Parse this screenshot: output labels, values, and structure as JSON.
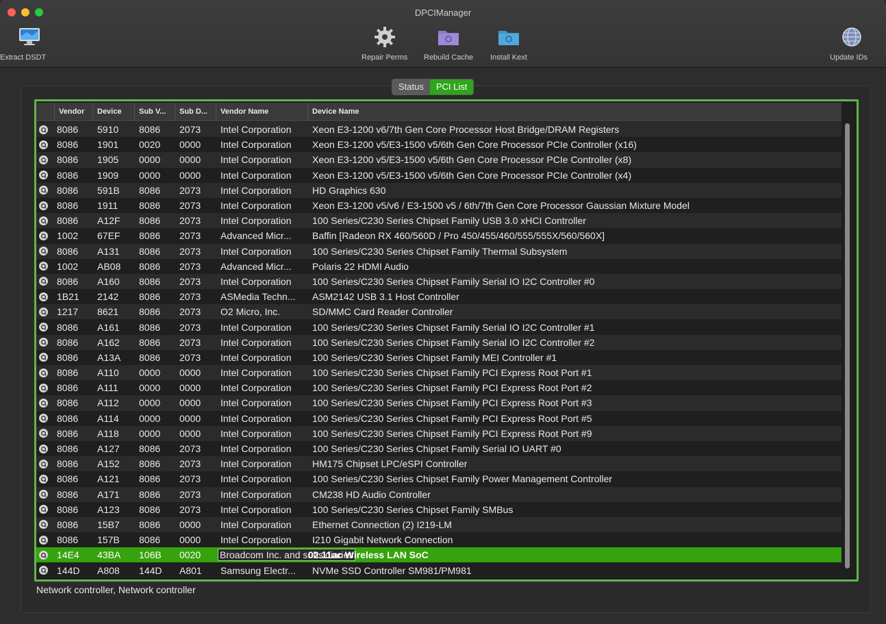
{
  "window": {
    "title": "DPCIManager"
  },
  "toolbar": {
    "extract_dsdt": "Extract DSDT",
    "repair_perms": "Repair Perms",
    "rebuild_cache": "Rebuild Cache",
    "install_kext": "Install Kext",
    "update_ids": "Update IDs"
  },
  "tabs": {
    "status": "Status",
    "pci_list": "PCI List",
    "active": "PCI List"
  },
  "table": {
    "columns": [
      "Vendor",
      "Device",
      "Sub V...",
      "Sub D...",
      "Vendor Name",
      "Device Name"
    ],
    "rows": [
      [
        "8086",
        "5910",
        "8086",
        "2073",
        "Intel Corporation",
        "Xeon E3-1200 v6/7th Gen Core Processor Host Bridge/DRAM Registers"
      ],
      [
        "8086",
        "1901",
        "0020",
        "0000",
        "Intel Corporation",
        "Xeon E3-1200 v5/E3-1500 v5/6th Gen Core Processor PCIe Controller (x16)"
      ],
      [
        "8086",
        "1905",
        "0000",
        "0000",
        "Intel Corporation",
        "Xeon E3-1200 v5/E3-1500 v5/6th Gen Core Processor PCIe Controller (x8)"
      ],
      [
        "8086",
        "1909",
        "0000",
        "0000",
        "Intel Corporation",
        "Xeon E3-1200 v5/E3-1500 v5/6th Gen Core Processor PCIe Controller (x4)"
      ],
      [
        "8086",
        "591B",
        "8086",
        "2073",
        "Intel Corporation",
        "HD Graphics 630"
      ],
      [
        "8086",
        "1911",
        "8086",
        "2073",
        "Intel Corporation",
        "Xeon E3-1200 v5/v6 / E3-1500 v5 / 6th/7th Gen Core Processor Gaussian Mixture Model"
      ],
      [
        "8086",
        "A12F",
        "8086",
        "2073",
        "Intel Corporation",
        "100 Series/C230 Series Chipset Family USB 3.0 xHCI Controller"
      ],
      [
        "1002",
        "67EF",
        "8086",
        "2073",
        "Advanced Micr...",
        "Baffin [Radeon RX 460/560D / Pro 450/455/460/555/555X/560/560X]"
      ],
      [
        "8086",
        "A131",
        "8086",
        "2073",
        "Intel Corporation",
        "100 Series/C230 Series Chipset Family Thermal Subsystem"
      ],
      [
        "1002",
        "AB08",
        "8086",
        "2073",
        "Advanced Micr...",
        "Polaris 22 HDMI Audio"
      ],
      [
        "8086",
        "A160",
        "8086",
        "2073",
        "Intel Corporation",
        "100 Series/C230 Series Chipset Family Serial IO I2C Controller #0"
      ],
      [
        "1B21",
        "2142",
        "8086",
        "2073",
        "ASMedia Techn...",
        "ASM2142 USB 3.1 Host Controller"
      ],
      [
        "1217",
        "8621",
        "8086",
        "2073",
        "O2 Micro, Inc.",
        "SD/MMC Card Reader Controller"
      ],
      [
        "8086",
        "A161",
        "8086",
        "2073",
        "Intel Corporation",
        "100 Series/C230 Series Chipset Family Serial IO I2C Controller #1"
      ],
      [
        "8086",
        "A162",
        "8086",
        "2073",
        "Intel Corporation",
        "100 Series/C230 Series Chipset Family Serial IO I2C Controller #2"
      ],
      [
        "8086",
        "A13A",
        "8086",
        "2073",
        "Intel Corporation",
        "100 Series/C230 Series Chipset Family MEI Controller #1"
      ],
      [
        "8086",
        "A110",
        "0000",
        "0000",
        "Intel Corporation",
        "100 Series/C230 Series Chipset Family PCI Express Root Port #1"
      ],
      [
        "8086",
        "A111",
        "0000",
        "0000",
        "Intel Corporation",
        "100 Series/C230 Series Chipset Family PCI Express Root Port #2"
      ],
      [
        "8086",
        "A112",
        "0000",
        "0000",
        "Intel Corporation",
        "100 Series/C230 Series Chipset Family PCI Express Root Port #3"
      ],
      [
        "8086",
        "A114",
        "0000",
        "0000",
        "Intel Corporation",
        "100 Series/C230 Series Chipset Family PCI Express Root Port #5"
      ],
      [
        "8086",
        "A118",
        "0000",
        "0000",
        "Intel Corporation",
        "100 Series/C230 Series Chipset Family PCI Express Root Port #9"
      ],
      [
        "8086",
        "A127",
        "8086",
        "2073",
        "Intel Corporation",
        "100 Series/C230 Series Chipset Family Serial IO UART #0"
      ],
      [
        "8086",
        "A152",
        "8086",
        "2073",
        "Intel Corporation",
        "HM175 Chipset LPC/eSPI Controller"
      ],
      [
        "8086",
        "A121",
        "8086",
        "2073",
        "Intel Corporation",
        "100 Series/C230 Series Chipset Family Power Management Controller"
      ],
      [
        "8086",
        "A171",
        "8086",
        "2073",
        "Intel Corporation",
        "CM238 HD Audio Controller"
      ],
      [
        "8086",
        "A123",
        "8086",
        "2073",
        "Intel Corporation",
        "100 Series/C230 Series Chipset Family SMBus"
      ],
      [
        "8086",
        "15B7",
        "8086",
        "0000",
        "Intel Corporation",
        "Ethernet Connection (2) I219-LM"
      ],
      [
        "8086",
        "157B",
        "8086",
        "0000",
        "Intel Corporation",
        "I210 Gigabit Network Connection"
      ],
      [
        "14E4",
        "43BA",
        "106B",
        "0020",
        "Broadcom Inc. and subsidiaries",
        "02.11ac Wireless LAN SoC"
      ],
      [
        "144D",
        "A808",
        "144D",
        "A801",
        "Samsung Electr...",
        "NVMe SSD Controller SM981/PM981"
      ]
    ],
    "selected_row": 28
  },
  "status_text": "Network controller, Network controller",
  "colors": {
    "accent": "#36a20d",
    "border": "#5fb64c",
    "tab_active": "#2fa41d"
  },
  "icons": [
    "monitor-icon",
    "gear-icon",
    "folder-gear-icon",
    "folder-kext-icon",
    "globe-icon",
    "info-icon"
  ]
}
